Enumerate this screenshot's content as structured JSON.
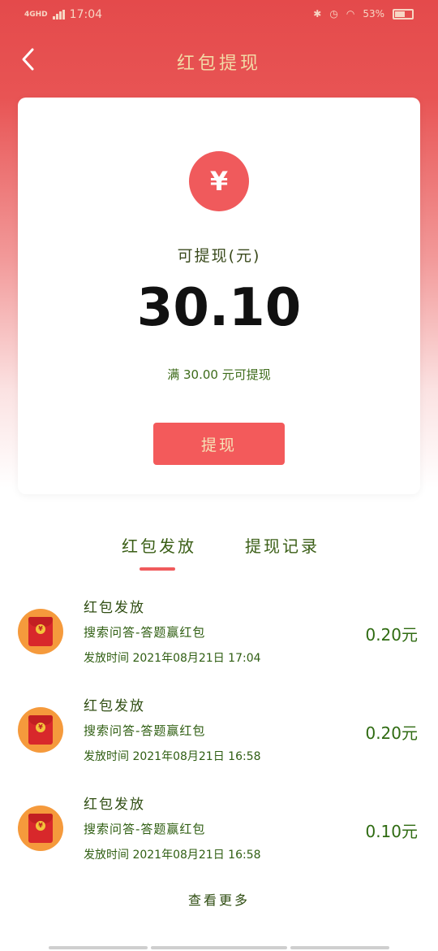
{
  "status": {
    "network": "4GHD",
    "time": "17:04",
    "battery": "53%"
  },
  "nav": {
    "title": "红包提现"
  },
  "card": {
    "balance_label": "可提现(元)",
    "balance_amount": "30.10",
    "threshold_text": "满 30.00 元可提现",
    "withdraw_button": "提现"
  },
  "tabs": [
    {
      "label": "红包发放",
      "active": true
    },
    {
      "label": "提现记录",
      "active": false
    }
  ],
  "records": [
    {
      "title": "红包发放",
      "desc": "搜索问答-答题赢红包",
      "time": "发放时间 2021年08月21日 17:04",
      "amount": "0.20元"
    },
    {
      "title": "红包发放",
      "desc": "搜索问答-答题赢红包",
      "time": "发放时间 2021年08月21日 16:58",
      "amount": "0.20元"
    },
    {
      "title": "红包发放",
      "desc": "搜索问答-答题赢红包",
      "time": "发放时间 2021年08月21日 16:58",
      "amount": "0.10元"
    }
  ],
  "more_label": "查看更多",
  "colors": {
    "header_red": "#e44a4b",
    "accent_red": "#f05a5c",
    "text_green": "#2f5e12",
    "icon_orange": "#f59a3c"
  }
}
